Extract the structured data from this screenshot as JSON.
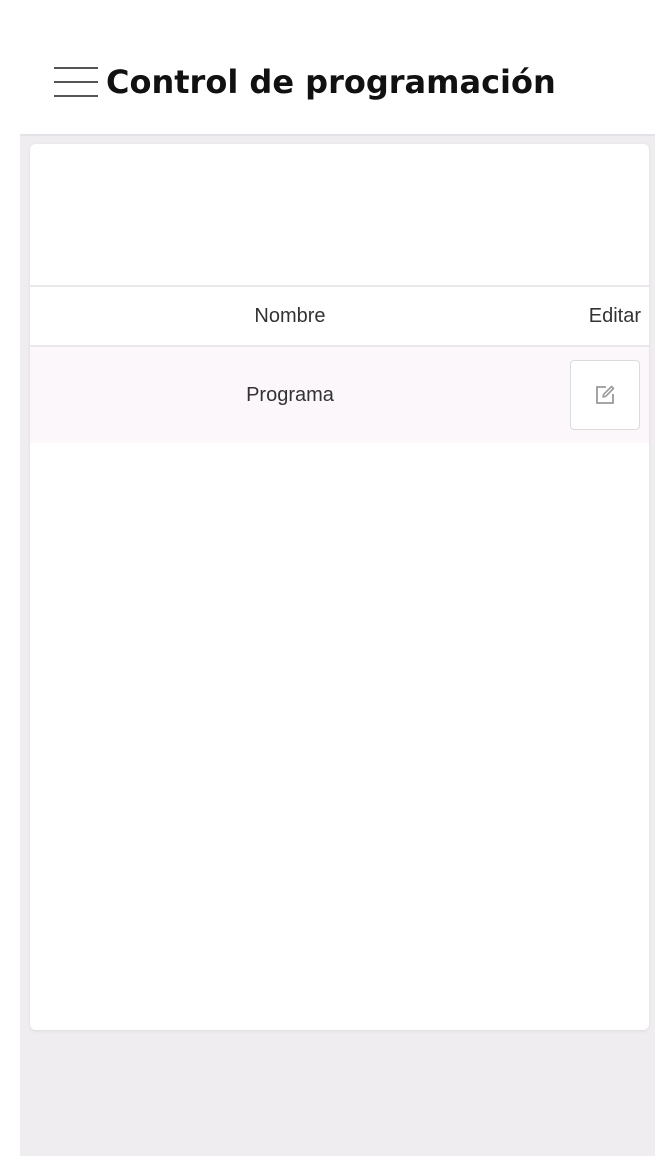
{
  "header": {
    "title": "Control de programación",
    "menu_icon": "hamburger-menu-icon"
  },
  "table": {
    "columns": [
      "Nombre",
      "Editar"
    ],
    "rows": [
      {
        "nombre": "Programa",
        "edit_icon": "edit-icon"
      }
    ]
  },
  "colors": {
    "background": "#efedf0",
    "row_background": "#fbf7fb",
    "title": "#111111"
  }
}
